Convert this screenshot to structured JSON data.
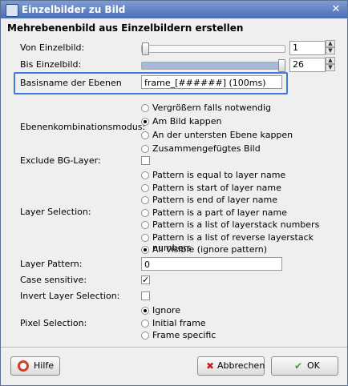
{
  "window": {
    "title": "Einzelbilder zu Bild",
    "heading": "Mehrebenenbild aus Einzelbildern erstellen"
  },
  "von": {
    "label": "Von Einzelbild:",
    "value": "1",
    "level": 0.0
  },
  "bis": {
    "label": "Bis Einzelbild:",
    "value": "26",
    "level": 1.0
  },
  "basisname": {
    "label": "Basisname der Ebenen",
    "value": "frame_[######] (100ms)"
  },
  "kombination": {
    "label": "Ebenenkombinationsmodus:",
    "options": [
      {
        "label": "Vergrößern falls notwendig",
        "selected": false
      },
      {
        "label": "Am Bild kappen",
        "selected": true
      },
      {
        "label": "An der untersten Ebene kappen",
        "selected": false
      },
      {
        "label": "Zusammengefügtes Bild",
        "selected": false
      }
    ]
  },
  "exclude_bg": {
    "label": "Exclude BG-Layer:",
    "checked": false
  },
  "layer_selection": {
    "label": "Layer Selection:",
    "options": [
      {
        "label": "Pattern is equal to layer name",
        "selected": false
      },
      {
        "label": "Pattern is start of layer name",
        "selected": false
      },
      {
        "label": "Pattern is end of layer name",
        "selected": false
      },
      {
        "label": "Pattern is a part of layer name",
        "selected": false
      },
      {
        "label": "Pattern is a list of layerstack numbers",
        "selected": false
      },
      {
        "label": "Pattern is a list of reverse layerstack numbers",
        "selected": false
      },
      {
        "label": "All visible (ignore pattern)",
        "selected": true
      }
    ]
  },
  "layer_pattern": {
    "label": "Layer Pattern:",
    "value": "0"
  },
  "case_sensitive": {
    "label": "Case sensitive:",
    "checked": true
  },
  "invert": {
    "label": "Invert Layer Selection:",
    "checked": false
  },
  "pixel_selection": {
    "label": "Pixel Selection:",
    "options": [
      {
        "label": "Ignore",
        "selected": true
      },
      {
        "label": "Initial frame",
        "selected": false
      },
      {
        "label": "Frame specific",
        "selected": false
      }
    ]
  },
  "buttons": {
    "help": "Hilfe",
    "cancel": "Abbrechen",
    "ok": "OK"
  },
  "icons": {
    "help": "lifebuoy-icon",
    "cancel": "cross-icon",
    "ok": "checkmark-icon",
    "close": "close-icon"
  },
  "colors": {
    "accent": "#3d7ad9",
    "titlebar": "#4a6fb7"
  }
}
